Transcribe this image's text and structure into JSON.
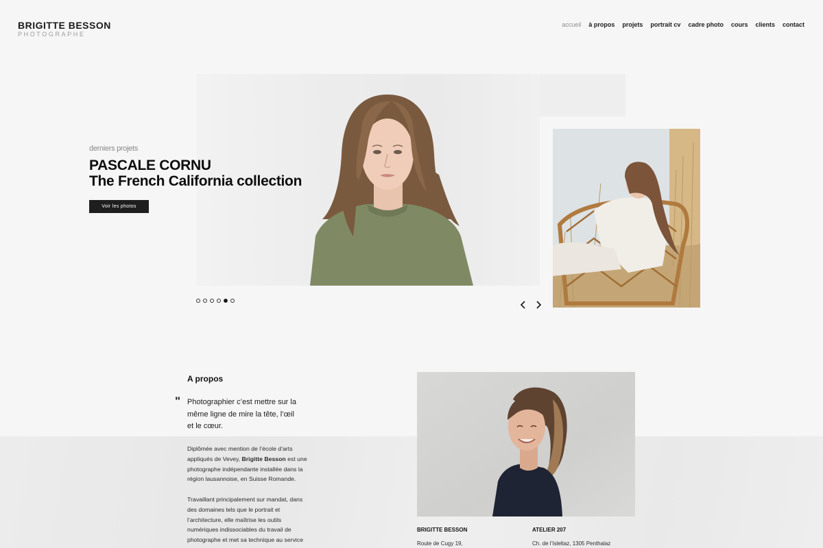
{
  "brand": {
    "name": "BRIGITTE BESSON",
    "subtitle": "PHOTOGRAPHE"
  },
  "nav": [
    "accueil",
    "à propos",
    "projets",
    "portrait cv",
    "cadre photo",
    "cours",
    "clients",
    "contact"
  ],
  "nav_active": "accueil",
  "hero": {
    "kicker": "derniers projets",
    "title_line1": "PASCALE CORNU",
    "title_line2": "The French California collection",
    "button": "Voir les photos",
    "slide_count": 6,
    "active_slide": 5
  },
  "about": {
    "title": "A propos",
    "quote_mark": "\"",
    "quote_lines": [
      "Photographier c’est mettre sur la",
      "même ligne de mire la tête, l’œil",
      "et le cœur."
    ],
    "para1_lines": [
      "Diplômée avec mention de l’école d’arts",
      "appliqués de Vevey, ",
      "Brigitte Besson",
      " est une",
      "photographe indépendante installée dans la",
      "région lausannoise, en Suisse Romande."
    ],
    "para2_lines": [
      "Travaillant principalement sur mandat, dans",
      "des domaines tels que le portrait et",
      "l’architecture, elle maîtrise les outils",
      "numériques indissociables du travail de",
      "photographe et met sa technique au service"
    ]
  },
  "contacts": [
    {
      "name": "BRIGITTE BESSON",
      "line": "Route de Cugy 19,"
    },
    {
      "name": "ATELIER 207",
      "line": "Ch. de l’Isleltaz, 1305 Penthalaz"
    }
  ],
  "colors": {
    "background": "#f6f6f6",
    "button": "#1e1e1e",
    "nav_active": "#8d8d8d"
  }
}
